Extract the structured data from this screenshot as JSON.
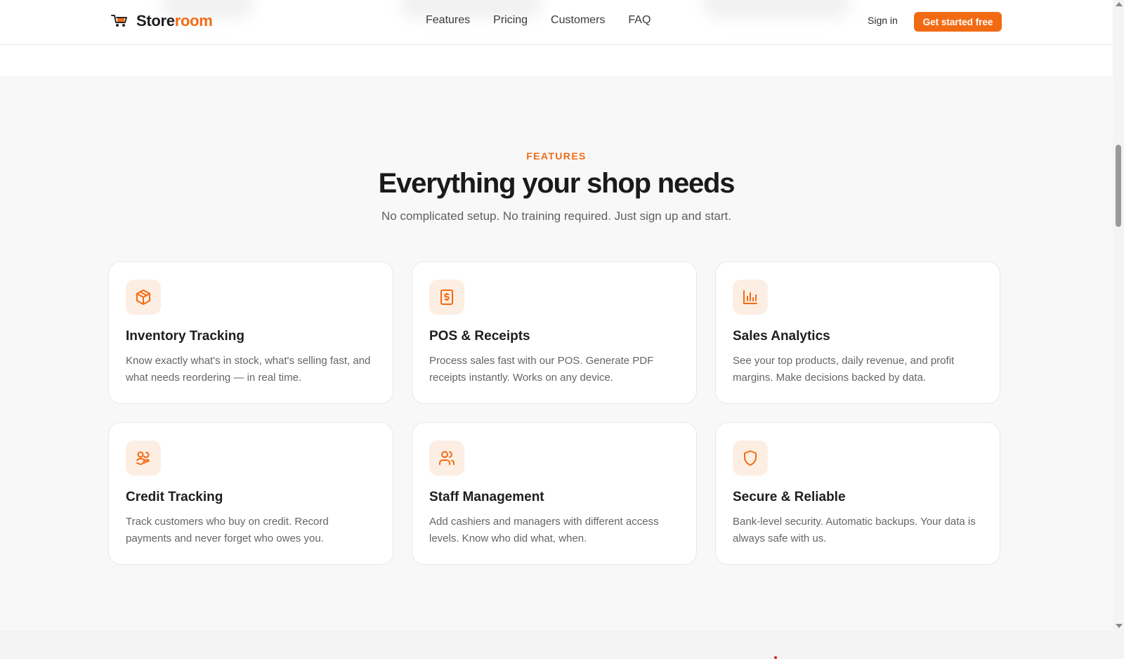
{
  "brand": {
    "name_part1": "Store",
    "name_part2": "room",
    "accent_color": "#f26b14",
    "logo_icon": "cart-icon"
  },
  "nav": {
    "items": [
      {
        "label": "Features"
      },
      {
        "label": "Pricing"
      },
      {
        "label": "Customers"
      },
      {
        "label": "FAQ"
      }
    ]
  },
  "header": {
    "signin_label": "Sign in",
    "cta_label": "Get started free"
  },
  "features": {
    "eyebrow": "FEATURES",
    "title": "Everything your shop needs",
    "subtitle": "No complicated setup. No training required. Just sign up and start.",
    "cards": [
      {
        "icon": "box-icon",
        "title": "Inventory Tracking",
        "desc": "Know exactly what's in stock, what's selling fast, and what needs reordering — in real time."
      },
      {
        "icon": "receipt-icon",
        "title": "POS & Receipts",
        "desc": "Process sales fast with our POS. Generate PDF receipts instantly. Works on any device."
      },
      {
        "icon": "bar-chart-icon",
        "title": "Sales Analytics",
        "desc": "See your top products, daily revenue, and profit margins. Make decisions backed by data."
      },
      {
        "icon": "hand-coins-icon",
        "title": "Credit Tracking",
        "desc": "Track customers who buy on credit. Record payments and never forget who owes you."
      },
      {
        "icon": "users-icon",
        "title": "Staff Management",
        "desc": "Add cashiers and managers with different access levels. Know who did what, when."
      },
      {
        "icon": "shield-icon",
        "title": "Secure & Reliable",
        "desc": "Bank-level security. Automatic backups. Your data is always safe with us."
      }
    ]
  }
}
